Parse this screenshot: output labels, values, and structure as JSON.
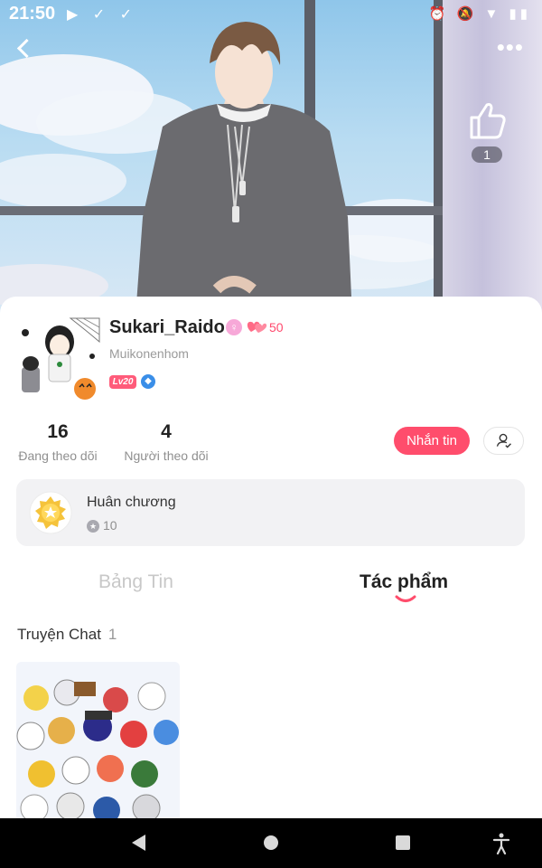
{
  "status_bar": {
    "time": "21:50",
    "left_icons": "▶ ✓ ✓",
    "right_icons": "⏰ 🔕 ▼ ▮▮"
  },
  "hero": {
    "like_count": "1"
  },
  "profile": {
    "username": "Sukari_Raido",
    "points": "50",
    "handle": "Muikonenhom",
    "level_badge": "Lv20",
    "gender_symbol": "♀",
    "rank_symbol": "◆"
  },
  "stats": [
    {
      "value": "16",
      "label": "Đang theo dõi"
    },
    {
      "value": "4",
      "label": "Người theo dõi"
    }
  ],
  "actions": {
    "message_label": "Nhắn tin"
  },
  "medals": {
    "title": "Huân chương",
    "count": "10"
  },
  "tabs": [
    {
      "label": "Bảng Tin",
      "active": false
    },
    {
      "label": "Tác phẩm",
      "active": true
    }
  ],
  "section": {
    "title": "Truyện Chat",
    "count": "1"
  },
  "colors": {
    "accent": "#ff4d6c",
    "level_badge": "#ff5b7a",
    "rank_badge": "#3a8ee8"
  },
  "icons": [
    "back-icon",
    "more-icon",
    "thumbs-up-icon",
    "heart-icon",
    "star-icon",
    "follow-user-icon",
    "nav-back-icon",
    "nav-home-icon",
    "nav-recent-icon",
    "accessibility-icon"
  ]
}
